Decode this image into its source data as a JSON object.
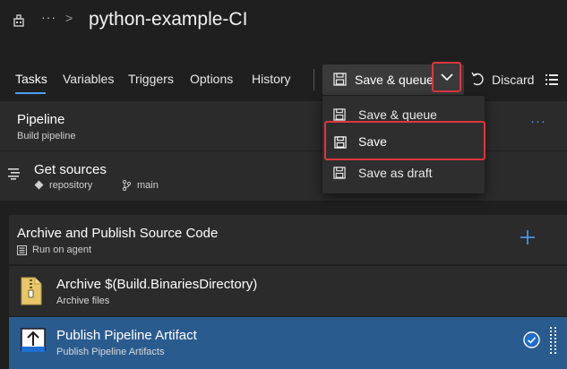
{
  "header": {
    "title": "python-example-CI",
    "build_icon": "build-pipeline-icon",
    "more_icon": "ellipsis-icon",
    "breadcrumb_separator_icon": "chevron-right-icon"
  },
  "tabs": [
    {
      "label": "Tasks",
      "active": true
    },
    {
      "label": "Variables"
    },
    {
      "label": "Triggers"
    },
    {
      "label": "Options"
    },
    {
      "label": "History"
    }
  ],
  "toolbar": {
    "save_queue_label": "Save & queue",
    "discard_label": "Discard"
  },
  "dropdown_menu": {
    "items": [
      {
        "label": "Save & queue",
        "icon": "floppy-disk-icon"
      },
      {
        "label": "Save",
        "icon": "floppy-disk-icon"
      },
      {
        "label": "Save as draft",
        "icon": "floppy-disk-icon"
      }
    ]
  },
  "pipeline": {
    "title": "Pipeline",
    "subtitle": "Build pipeline"
  },
  "sources": {
    "title": "Get sources",
    "repository": "repository",
    "branch": "main"
  },
  "job": {
    "title": "Archive and Publish Source Code",
    "subtitle": "Run on agent"
  },
  "tasks": [
    {
      "title": "Archive $(Build.BinariesDirectory)",
      "subtitle": "Archive files",
      "selected": false
    },
    {
      "title": "Publish Pipeline Artifact",
      "subtitle": "Publish Pipeline Artifacts",
      "selected": true
    }
  ],
  "colors": {
    "accent": "#4aa0f5",
    "highlight_border": "#e0363c",
    "selected_row": "#2a5b8f",
    "background": "#1f1f1f",
    "panel": "#2b2b2b"
  }
}
